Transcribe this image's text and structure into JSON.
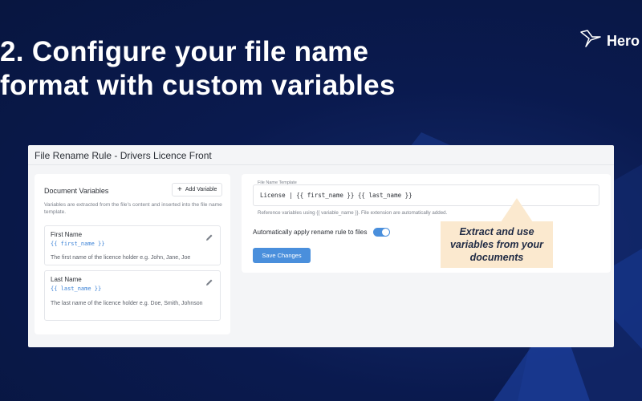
{
  "slide": {
    "title_line1": "2. Configure your file name",
    "title_line2": "format with custom variables"
  },
  "brand": {
    "name": "Hero",
    "icon": "bird-logo-icon"
  },
  "panel": {
    "title": "File Rename Rule - Drivers Licence Front",
    "variables": {
      "heading": "Document Variables",
      "add_label": "Add Variable",
      "description": "Variables are extracted from the file's content and inserted into the file name template.",
      "items": [
        {
          "name": "First Name",
          "code": "{{ first_name }}",
          "description": "The first name of the licence holder e.g. John, Jane, Joe"
        },
        {
          "name": "Last Name",
          "code": "{{ last_name }}",
          "description": "The last name of the licence holder e.g. Doe, Smith, Johnson"
        }
      ]
    },
    "template": {
      "label": "File Name Template",
      "value": "License | {{ first_name }} {{ last_name }}",
      "help": "Reference variables using {{ variable_name }}. File extension are automatically added.",
      "auto_apply_label": "Automatically apply rename rule to files",
      "auto_apply_enabled": true,
      "save_label": "Save Changes"
    }
  },
  "callout": {
    "text": "Extract and use variables from your documents"
  },
  "colors": {
    "background": "#0a1a4f",
    "accent_blue": "#4a8fdc",
    "callout_bg": "#fbe9cf"
  }
}
